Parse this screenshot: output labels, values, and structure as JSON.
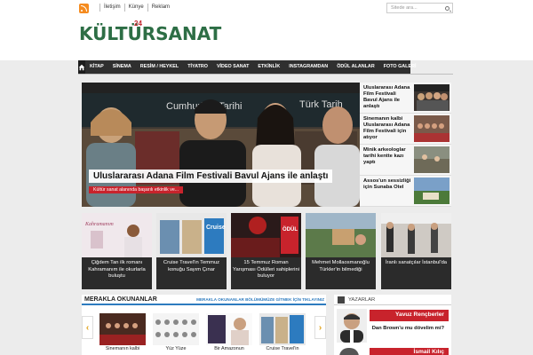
{
  "topbar": {
    "links": [
      "İletişim",
      "Künye",
      "Reklam"
    ],
    "search_placeholder": "Sitede ara..."
  },
  "logo": {
    "text": "KÜLTÜRSANAT",
    "number": "24"
  },
  "nav": {
    "items": [
      "KİTAP",
      "SİNEMA",
      "RESİM / HEYKEL",
      "TİYATRO",
      "VİDEO SANAT",
      "ETKİNLİK",
      "INSTAGRAMDAN",
      "ÖDÜL ALANLAR",
      "FOTO GALERİ"
    ]
  },
  "hero": {
    "title": "Uluslararası Adana Film Festivali Bavul Ajans ile anlaştı",
    "subtitle": "Kültür sanat alanında başarılı etkinlik ve...",
    "backdrop_texts": [
      "Cumhuriyet Tarihi",
      "Türk Tarih"
    ]
  },
  "side_headlines": [
    {
      "title": "Uluslararası Adana Film Festivali Bavul Ajans ile anlaştı"
    },
    {
      "title": "Sinemanın kalbi Uluslararası Adana Film Festivali için atıyor"
    },
    {
      "title": "Minik arkeologlar tarihi kentte kazı yaptı"
    },
    {
      "title": "Assos'un sessizliği için Sunaba Otel"
    }
  ],
  "cards": [
    {
      "title": "Çiğdem Tan ilk romanı Kahramanım ile okurlarla buluştu",
      "thumb_text": "Kahramanım"
    },
    {
      "title": "Cruise Travel'in Temmuz konuğu Sayım Çınar",
      "thumb_text": "Cruise"
    },
    {
      "title": "15 Temmuz Roman Yarışması Ödülleri sahiplerini buluyor",
      "thumb_text": "ÖDÜL"
    },
    {
      "title": "Mehmet Mollaosmanoğlu Türkler'in bilmediği",
      "thumb_text": ""
    },
    {
      "title": "İranlı sanatçılar İstanbul'da",
      "thumb_text": ""
    }
  ],
  "merakla": {
    "title": "MERAKLA OKUNANLAR",
    "link": "MERAKLA OKUNANLAR BÖLÜMÜMÜZE GİTMEK İÇİN TIKLAYINIZ",
    "items": [
      "Sinemanın kalbi",
      "Yüz Yüze",
      "Bir Amazonun",
      "Cruise Travel'in"
    ],
    "prev_label": "‹",
    "next_label": "›"
  },
  "yazarlar": {
    "title": "YAZARLAR",
    "authors": [
      {
        "name": "Yavuz Rençberler",
        "article": "Dan Brown'u mu dövelim mi?"
      },
      {
        "name": "İsmail Kılıç",
        "article": ""
      }
    ]
  },
  "colors": {
    "accent_red": "#c8232c",
    "nav_bg": "#2f2f2f",
    "link_blue": "#2d7bbf",
    "logo_green": "#2d6e45"
  }
}
